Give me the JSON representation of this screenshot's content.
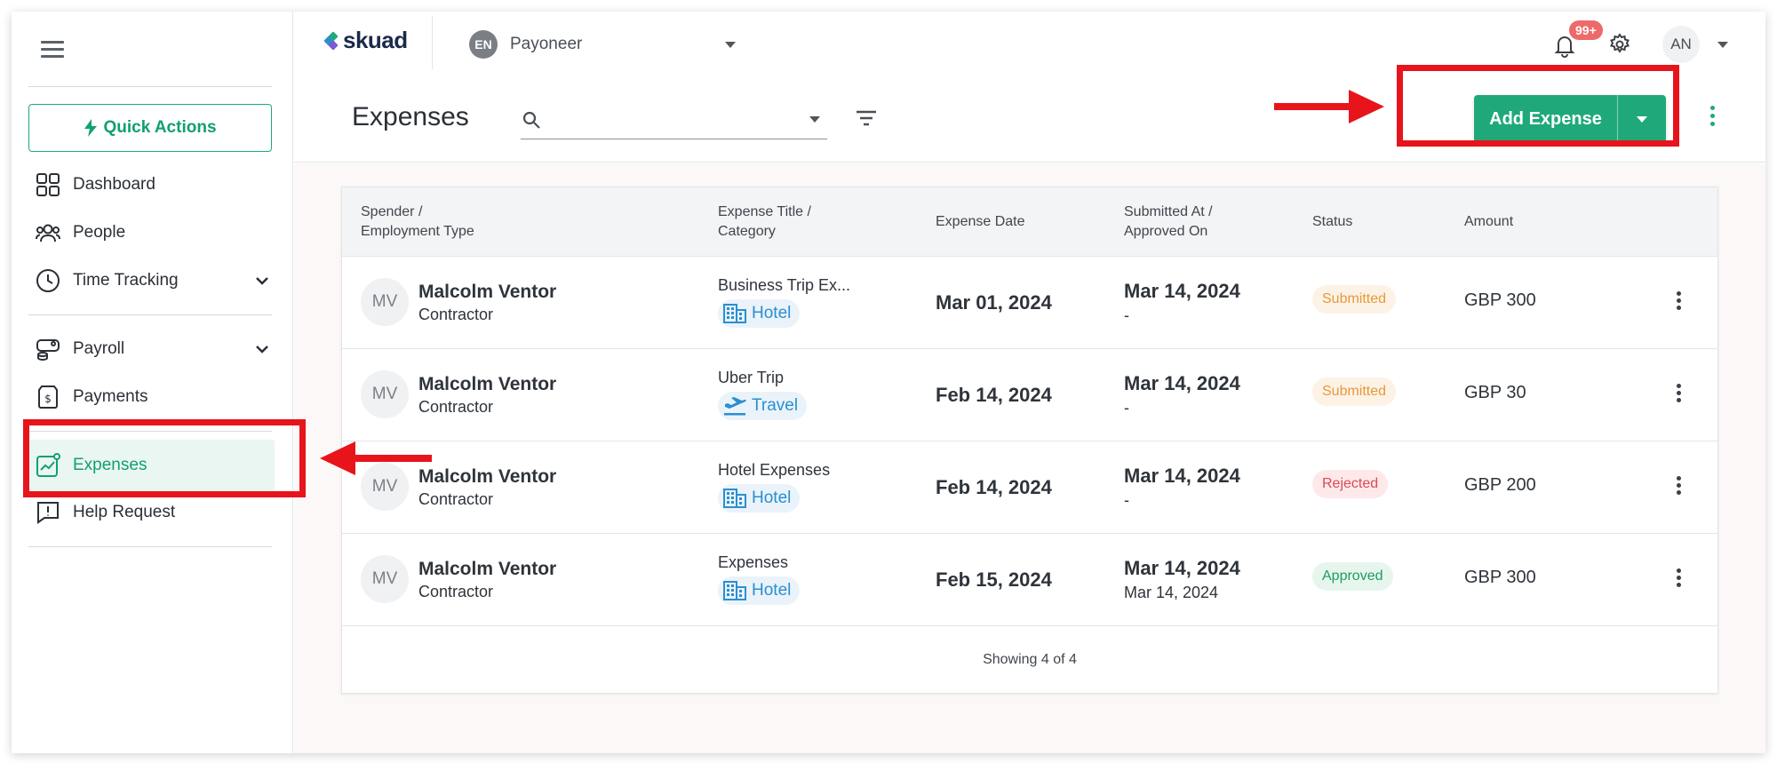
{
  "sidebar": {
    "quick_actions_label": "Quick Actions",
    "items": [
      {
        "label": "Dashboard"
      },
      {
        "label": "People"
      },
      {
        "label": "Time Tracking"
      },
      {
        "label": "Payroll"
      },
      {
        "label": "Payments"
      },
      {
        "label": "Expenses"
      },
      {
        "label": "Help Request"
      }
    ]
  },
  "header": {
    "logo_text": "skuad",
    "org_badge": "EN",
    "org_name": "Payoneer",
    "notification_count": "99+",
    "user_initials": "AN"
  },
  "page": {
    "title": "Expenses",
    "search_placeholder": "",
    "add_button_label": "Add Expense"
  },
  "table": {
    "headers": {
      "spender_line1": "Spender /",
      "spender_line2": "Employment Type",
      "title_line1": "Expense Title /",
      "title_line2": "Category",
      "date": "Expense Date",
      "submitted_line1": "Submitted At /",
      "submitted_line2": "Approved On",
      "status": "Status",
      "amount": "Amount"
    },
    "rows": [
      {
        "initials": "MV",
        "name": "Malcolm Ventor",
        "type": "Contractor",
        "title": "Business Trip Ex...",
        "category": "Hotel",
        "date": "Mar 01, 2024",
        "submitted": "Mar 14, 2024",
        "approved": "-",
        "status": "Submitted",
        "amount": "GBP 300"
      },
      {
        "initials": "MV",
        "name": "Malcolm Ventor",
        "type": "Contractor",
        "title": "Uber Trip",
        "category": "Travel",
        "date": "Feb 14, 2024",
        "submitted": "Mar 14, 2024",
        "approved": "-",
        "status": "Submitted",
        "amount": "GBP 30"
      },
      {
        "initials": "MV",
        "name": "Malcolm Ventor",
        "type": "Contractor",
        "title": "Hotel Expenses",
        "category": "Hotel",
        "date": "Feb 14, 2024",
        "submitted": "Mar 14, 2024",
        "approved": "-",
        "status": "Rejected",
        "amount": "GBP 200"
      },
      {
        "initials": "MV",
        "name": "Malcolm Ventor",
        "type": "Contractor",
        "title": "Expenses",
        "category": "Hotel",
        "date": "Feb 15, 2024",
        "submitted": "Mar 14, 2024",
        "approved": "Mar 14, 2024",
        "status": "Approved",
        "amount": "GBP 300"
      }
    ],
    "footer": "Showing 4 of 4"
  },
  "colors": {
    "brand_green": "#1fa97b",
    "annotation_red": "#e8141c",
    "category_blue": "#2a8fd0"
  },
  "icons": {
    "menu": "hamburger-icon",
    "quick_actions": "lightning-icon",
    "dashboard": "grid-icon",
    "people": "people-icon",
    "time_tracking": "clock-icon",
    "payroll": "payroll-icon",
    "payments": "payments-icon",
    "expenses": "expenses-chart-icon",
    "help": "help-request-icon",
    "search": "search-icon",
    "filter": "filter-icon",
    "bell": "bell-icon",
    "settings": "gear-icon",
    "hotel": "building-icon",
    "travel": "plane-icon",
    "more": "kebab-icon"
  }
}
